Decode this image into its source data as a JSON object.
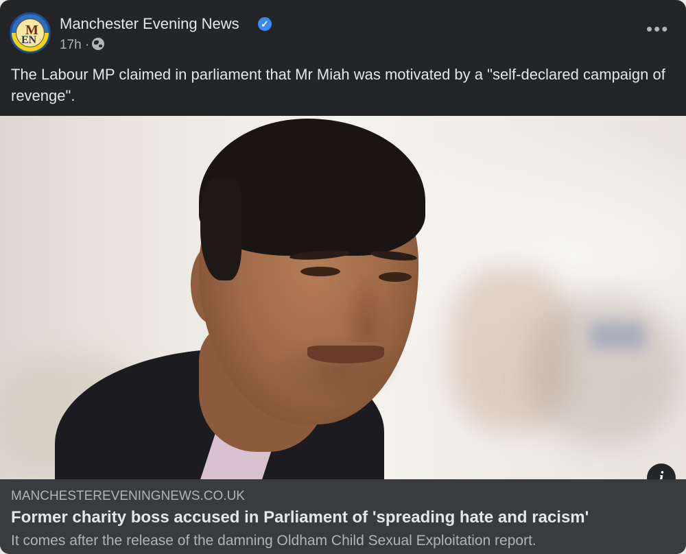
{
  "post": {
    "page_name": "Manchester Evening News",
    "verified_icon": "verified-badge-icon",
    "time": "17h ·",
    "audience_icon": "globe-icon",
    "more_label": "•••",
    "avatar_letters": {
      "top": "M",
      "bottom": "EN"
    },
    "caption": "The Labour MP claimed in parliament that Mr Miah was motivated by a \"self-declared campaign of revenge\"."
  },
  "link": {
    "domain": "MANCHESTEREVENINGNEWS.CO.UK",
    "title": "Former charity boss accused in Parliament of 'spreading hate and racism'",
    "description": "It comes after the release of the damning Oldham Child Sexual Exploitation report.",
    "info_label": "i"
  },
  "colors": {
    "card_bg": "#242526",
    "link_bg": "#3a3b3c",
    "primary_text": "#e4e6eb",
    "secondary_text": "#b0b3b8",
    "verified_blue": "#3a8af0"
  }
}
